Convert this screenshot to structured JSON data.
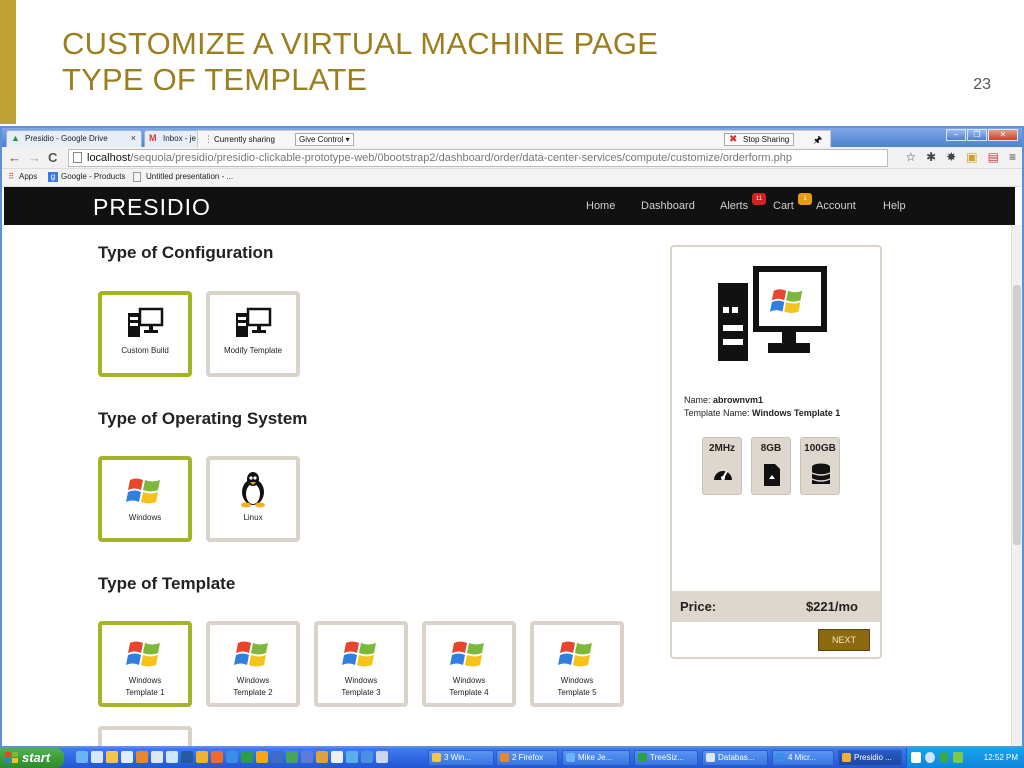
{
  "slide": {
    "title_line1": "CUSTOMIZE A VIRTUAL MACHINE PAGE",
    "title_line2": "TYPE OF TEMPLATE",
    "page_number": "23"
  },
  "browser": {
    "tabs": [
      {
        "label": "Presidio - Google Drive"
      },
      {
        "label": "Inbox - je"
      }
    ],
    "sharing": {
      "status": "Currently sharing",
      "give_control": "Give Control ▾",
      "stop_sharing": "Stop Sharing"
    },
    "url_host": "localhost",
    "url_path": "/sequoia/presidio/presidio-clickable-prototype-web/0bootstrap2/dashboard/order/data-center-services/compute/customize/orderform.php",
    "bookmarks": [
      {
        "label": "Apps"
      },
      {
        "label": "Google - Products"
      },
      {
        "label": "Untitled presentation - ..."
      }
    ]
  },
  "app": {
    "logo": "PRESIDIO",
    "nav": {
      "home": "Home",
      "dashboard": "Dashboard",
      "alerts": "Alerts",
      "alerts_count": "11",
      "cart": "Cart",
      "cart_count": "1",
      "account": "Account",
      "help": "Help"
    },
    "config": {
      "heading": "Type of Configuration",
      "options": [
        {
          "label": "Custom Build",
          "selected": true
        },
        {
          "label": "Modify Template",
          "selected": false
        }
      ]
    },
    "os": {
      "heading": "Type of Operating System",
      "options": [
        {
          "label": "Windows",
          "selected": true
        },
        {
          "label": "Linux",
          "selected": false
        }
      ]
    },
    "template": {
      "heading": "Type of Template",
      "options": [
        {
          "line1": "Windows",
          "line2": "Template 1",
          "selected": true
        },
        {
          "line1": "Windows",
          "line2": "Template 2",
          "selected": false
        },
        {
          "line1": "Windows",
          "line2": "Template 3",
          "selected": false
        },
        {
          "line1": "Windows",
          "line2": "Template 4",
          "selected": false
        },
        {
          "line1": "Windows",
          "line2": "Template 5",
          "selected": false
        }
      ]
    },
    "summary": {
      "name_label": "Name:",
      "name_value": "abrownvm1",
      "template_label": "Template Name:",
      "template_value": "Windows Template 1",
      "specs": [
        {
          "value": "2MHz",
          "icon": "speedometer-icon"
        },
        {
          "value": "8GB",
          "icon": "memory-card-icon"
        },
        {
          "value": "100GB",
          "icon": "database-icon"
        }
      ],
      "price_label": "Price:",
      "price_value": "$221/mo",
      "next_label": "NEXT"
    }
  },
  "taskbar": {
    "start": "start",
    "buttons": [
      {
        "label": "3 Win..."
      },
      {
        "label": "2 Firefox"
      },
      {
        "label": "Mike Je..."
      },
      {
        "label": "TreeSiz..."
      },
      {
        "label": "Databas..."
      },
      {
        "label": "4 Micr..."
      },
      {
        "label": "Presidio ..."
      }
    ],
    "clock": "12:52 PM"
  },
  "colors": {
    "accent_gold": "#9c7e1f",
    "selected_border": "#a4b42a",
    "next_button": "#8c6a12"
  }
}
